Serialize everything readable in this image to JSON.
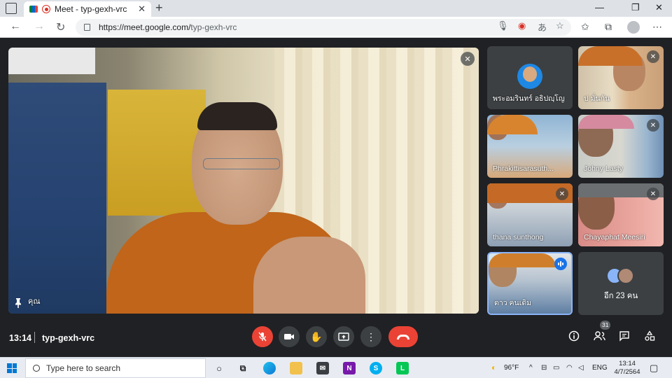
{
  "browser": {
    "tab_title": "Meet - typ-gexh-vrc",
    "url_host": "https://meet.google.com/",
    "url_path": "typ-gexh-vrc",
    "new_tab_label": "+",
    "close_tab_label": "✕"
  },
  "main_video": {
    "participant_name": "คุณ",
    "muted": true
  },
  "tiles": [
    {
      "name": "พระอมรินทร์ อธิปญฺโญ",
      "muted": false,
      "type": "avatar"
    },
    {
      "name": "ป มั่นกัน",
      "muted": true,
      "type": "video"
    },
    {
      "name": "Phrakittisarasuth...",
      "muted": false,
      "type": "video"
    },
    {
      "name": "Johny Lasty",
      "muted": true,
      "type": "video"
    },
    {
      "name": "thana sunthong",
      "muted": true,
      "type": "video"
    },
    {
      "name": "Chayaphat Meesiri",
      "muted": true,
      "type": "video"
    },
    {
      "name": "ดาว คนเดิม",
      "muted": false,
      "speaking": true,
      "type": "video"
    }
  ],
  "more_participants": {
    "label": "อีก 23 คน"
  },
  "controls": {
    "time": "13:14",
    "meeting_code": "typ-gexh-vrc",
    "participant_count": "31"
  },
  "taskbar": {
    "search_placeholder": "Type here to search",
    "weather": "96°F",
    "language": "ENG",
    "time": "13:14",
    "date": "4/7/2564"
  },
  "colors": {
    "meet_bg": "#202124",
    "control_bg": "#3c4043",
    "danger": "#ea4335",
    "accent": "#1a73e8"
  }
}
